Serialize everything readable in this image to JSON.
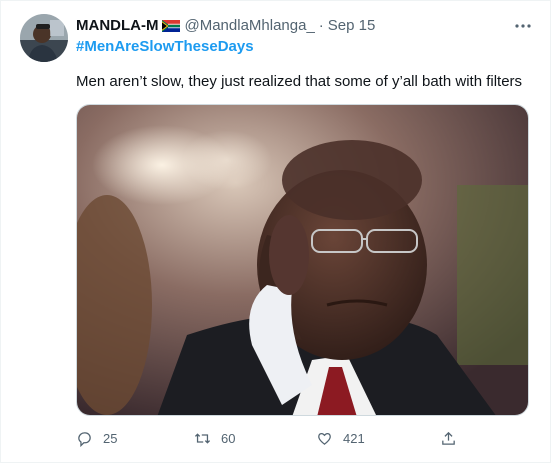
{
  "tweet": {
    "author_name": "MANDLA-M",
    "flag": "south-africa-flag",
    "handle": "@MandlaMhlanga_",
    "separator": "·",
    "date": "Sep 15",
    "hashtag": "#MenAreSlowTheseDays",
    "text": "Men aren’t slow, they just realized that some of y’all bath with filters",
    "media_icon": "photo-of-man-scratching-head"
  },
  "actions": {
    "reply_count": "25",
    "retweet_count": "60",
    "like_count": "421"
  },
  "colors": {
    "link": "#1d9bf0",
    "secondary_text": "#536471",
    "primary_text": "#0f1419"
  }
}
